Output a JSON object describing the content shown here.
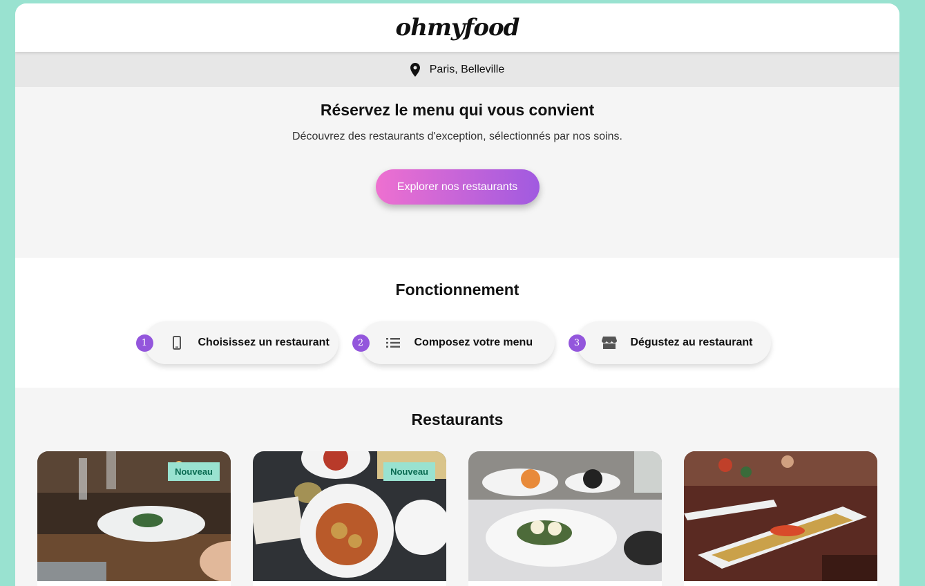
{
  "header": {
    "logo": "ohmyfood"
  },
  "location": {
    "text": "Paris, Belleville",
    "icon": "map-pin-icon"
  },
  "hero": {
    "title": "Réservez le menu qui vous convient",
    "subtitle": "Découvrez des restaurants d'exception, sélectionnés par nos soins.",
    "cta_label": "Explorer nos restaurants"
  },
  "how": {
    "title": "Fonctionnement",
    "steps": [
      {
        "number": "1",
        "label": "Choisissez un restaurant",
        "icon": "mobile-phone-icon"
      },
      {
        "number": "2",
        "label": "Composez votre menu",
        "icon": "list-icon"
      },
      {
        "number": "3",
        "label": "Dégustez au restaurant",
        "icon": "store-icon"
      }
    ]
  },
  "restaurants": {
    "title": "Restaurants",
    "cards": [
      {
        "badge": "Nouveau"
      },
      {
        "badge": "Nouveau"
      },
      {
        "badge": ""
      },
      {
        "badge": ""
      }
    ]
  },
  "colors": {
    "background": "#99e2d0",
    "accent_gradient_start": "#ee70d0",
    "accent_gradient_end": "#a05ae0",
    "step_number": "#9356dc",
    "badge_bg": "#99e2d0"
  }
}
